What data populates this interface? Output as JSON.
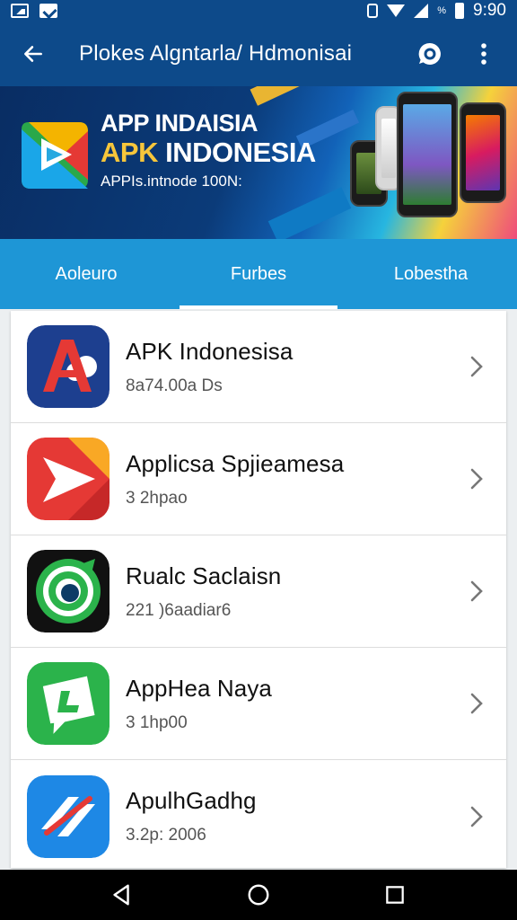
{
  "status_bar": {
    "time": "9:90",
    "battery_text": "%"
  },
  "app_bar": {
    "title": "Plokes Algntarla/ Hdmonisai"
  },
  "banner": {
    "line1": "APP INDAISIA",
    "line2_part1": "APK",
    "line2_part2": "INDONESIA",
    "subtitle": "APPIs.intnode 100N:"
  },
  "tabs": [
    {
      "label": "Aoleuro",
      "active": false
    },
    {
      "label": "Furbes",
      "active": true
    },
    {
      "label": "Lobestha",
      "active": false
    }
  ],
  "apps": [
    {
      "name": "APK Indonesisa",
      "meta": "8a74.00a Ds",
      "icon": "red-a-logo-icon",
      "color": "#1d3f8f"
    },
    {
      "name": "Applicsa Spjieamesa",
      "meta": "3 2hpao",
      "icon": "red-play-logo-icon",
      "color": "#e53935"
    },
    {
      "name": "Rualc Saclaisn",
      "meta": "221 )6aadiar6",
      "icon": "green-ring-logo-icon",
      "color": "#111111"
    },
    {
      "name": "AppHea Naya",
      "meta": "3 1hp00",
      "icon": "green-chat-logo-icon",
      "color": "#2bb34b"
    },
    {
      "name": "ApulhGadhg",
      "meta": "3.2p: 2006",
      "icon": "blue-arrow-logo-icon",
      "color": "#1e88e5"
    }
  ]
}
